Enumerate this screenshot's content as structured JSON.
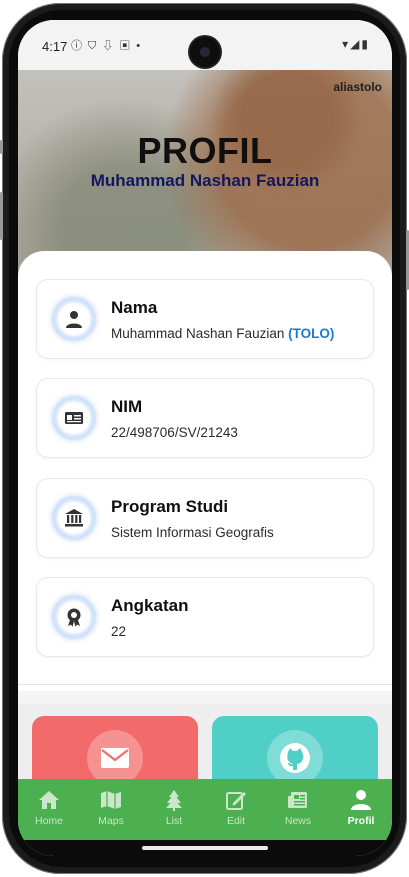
{
  "status_bar": {
    "time": "4:17",
    "left_icons": [
      "info-icon",
      "shield-icon",
      "download-icon",
      "a-icon",
      "dot-icon"
    ],
    "right_icons": [
      "wifi-icon",
      "signal-icon",
      "battery-icon"
    ]
  },
  "header": {
    "brand": "aliastolo",
    "title": "PROFIL",
    "subtitle": "Muhammad Nashan Fauzian"
  },
  "cards": [
    {
      "label": "Nama",
      "value": "Muhammad Nashan Fauzian",
      "highlight": "(TOLO)",
      "icon": "person-icon"
    },
    {
      "label": "NIM",
      "value": "22/498706/SV/21243",
      "icon": "id-card-icon"
    },
    {
      "label": "Program Studi",
      "value": "Sistem Informasi Geografis",
      "icon": "university-icon"
    },
    {
      "label": "Angkatan",
      "value": "22",
      "icon": "award-icon"
    }
  ],
  "tiles": [
    {
      "name": "email",
      "icon": "envelope-icon",
      "color": "#f26a6a"
    },
    {
      "name": "github",
      "icon": "github-icon",
      "color": "#4fcfc6"
    }
  ],
  "nav": {
    "items": [
      {
        "label": "Home",
        "icon": "home-icon"
      },
      {
        "label": "Maps",
        "icon": "map-icon"
      },
      {
        "label": "List",
        "icon": "tree-icon"
      },
      {
        "label": "Edit",
        "icon": "edit-icon"
      },
      {
        "label": "News",
        "icon": "newspaper-icon"
      },
      {
        "label": "Profil",
        "icon": "person-icon"
      }
    ],
    "active": "Profil"
  },
  "colors": {
    "accent": "#4caf50",
    "title_subtitle": "#14165f",
    "highlight": "#1e78d2"
  }
}
